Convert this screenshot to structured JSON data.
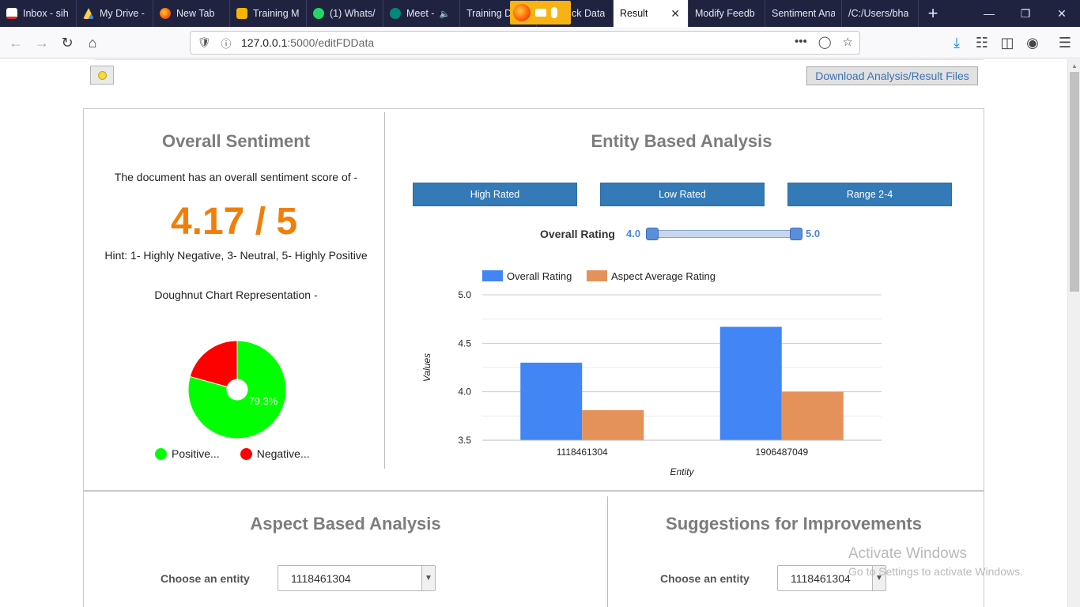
{
  "browser": {
    "tabs": [
      {
        "label": "Inbox - sih",
        "icon": "gmail-icon",
        "color": "#d93025"
      },
      {
        "label": "My Drive -",
        "icon": "drive-icon",
        "color": "#1fa463"
      },
      {
        "label": "New Tab",
        "icon": "firefox-icon",
        "color": "#ff6a00"
      },
      {
        "label": "Training M",
        "icon": "slides-icon",
        "color": "#f4b400"
      },
      {
        "label": "(1) Whats/",
        "icon": "whatsapp-icon",
        "color": "#25d366"
      },
      {
        "label": "Meet -",
        "icon": "meet-icon",
        "color": "#00897b"
      },
      {
        "label": "Training Da",
        "icon": "sheets-icon",
        "color": "#0f9d58"
      },
      {
        "label": "ck Data",
        "icon": "doc-icon",
        "color": "#4285f4"
      },
      {
        "label": "Result",
        "icon": "page-icon",
        "color": "#ffffff"
      },
      {
        "label": "Modify Feedb",
        "icon": "page-icon",
        "color": "#1f2340"
      },
      {
        "label": "Sentiment Ana",
        "icon": "page-icon",
        "color": "#1f2340"
      },
      {
        "label": "/C:/Users/bha",
        "icon": "page-icon",
        "color": "#1f2340"
      }
    ],
    "new_tab": "+",
    "window_controls": {
      "minimize": "—",
      "restore": "❐",
      "close": "✕"
    },
    "url_host": "127.0.0.1",
    "url_path": ":5000/editFDData",
    "url_menu": "•••"
  },
  "header": {
    "download_label": "Download Analysis/Result Files"
  },
  "overall": {
    "title": "Overall Sentiment",
    "intro": "The document has an overall sentiment score of -",
    "score": "4.17 / 5",
    "hint": "Hint: 1- Highly Negative, 3- Neutral, 5- Highly Positive",
    "chart_caption": "Doughnut Chart Representation -"
  },
  "entity": {
    "title": "Entity Based Analysis",
    "buttons": {
      "high": "High Rated",
      "low": "Low Rated",
      "range": "Range 2-4"
    },
    "rating_label": "Overall Rating",
    "rating_min": "4.0",
    "rating_max": "5.0"
  },
  "aspect": {
    "title": "Aspect Based Analysis",
    "choose_label": "Choose an entity",
    "selected": "1118461304"
  },
  "suggestions": {
    "title": "Suggestions for Improvements",
    "choose_label": "Choose an entity",
    "selected": "1118461304"
  },
  "watermark": {
    "line1": "Activate Windows",
    "line2": "Go to Settings to activate Windows."
  },
  "chart_data": [
    {
      "type": "pie",
      "title": "",
      "categories": [
        "Positive...",
        "Negative..."
      ],
      "values": [
        79.3,
        20.7
      ],
      "colors": [
        "#00ff00",
        "#ff0000"
      ],
      "data_labels": [
        "79.3%",
        ""
      ],
      "legend": "bottom"
    },
    {
      "type": "bar",
      "title": "",
      "categories": [
        "1118461304",
        "1906487049"
      ],
      "series": [
        {
          "name": "Overall Rating",
          "values": [
            4.3,
            4.67
          ],
          "color": "#4285f4"
        },
        {
          "name": "Aspect Average Rating",
          "values": [
            3.81,
            4.0
          ],
          "color": "#e4925a"
        }
      ],
      "xlabel": "Entity",
      "ylabel": "Values",
      "ylim": [
        3.5,
        5.0
      ],
      "yticks": [
        "3.5",
        "4.0",
        "4.5",
        "5.0"
      ],
      "grid": true,
      "legend": "top-left"
    }
  ]
}
